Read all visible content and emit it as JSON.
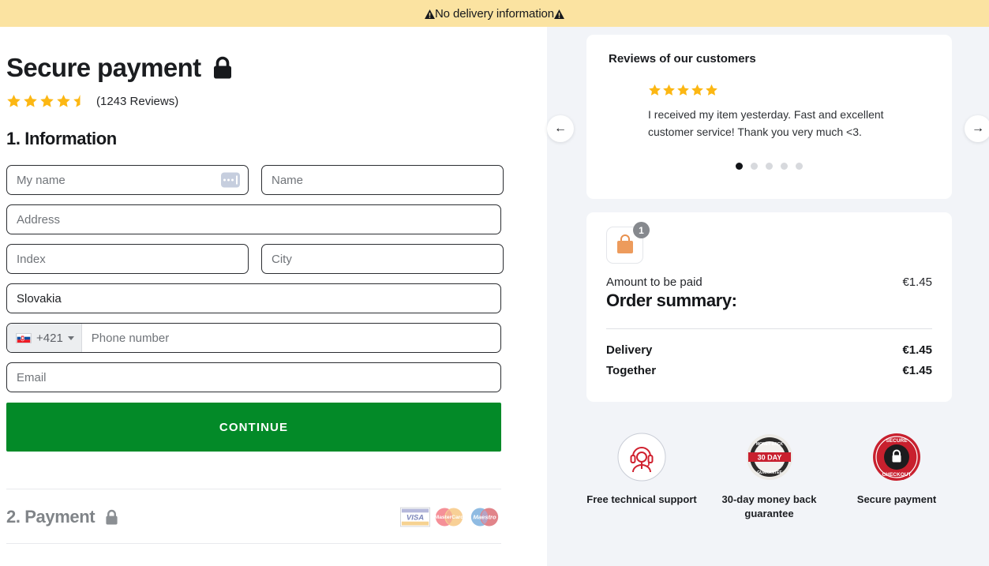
{
  "banner": {
    "text": "No delivery information",
    "icon_left": "warning-triangle-icon",
    "icon_right": "warning-triangle-icon",
    "bg_color": "#fbe3a1"
  },
  "header": {
    "title": "Secure payment",
    "lock_icon": "lock-icon",
    "rating_value": 4.5,
    "stars_total": 5,
    "reviews_text": "(1243 Reviews)"
  },
  "information": {
    "heading": "1. Information",
    "fields": {
      "my_name_placeholder": "My name",
      "name_placeholder": "Name",
      "address_placeholder": "Address",
      "index_placeholder": "Index",
      "city_placeholder": "City",
      "country_value": "Slovakia",
      "phone_dial_code": "+421",
      "phone_placeholder": "Phone number",
      "email_placeholder": "Email"
    },
    "continue_label": "CONTINUE"
  },
  "payment": {
    "heading": "2. Payment",
    "lock_icon": "lock-icon",
    "cards": [
      "VISA",
      "MasterCard",
      "Maestro"
    ]
  },
  "reviews": {
    "title": "Reviews of our customers",
    "stars": 5,
    "text": "I received my item yesterday. Fast and excellent customer service! Thank you very much <3.",
    "dots_total": 5,
    "active_dot": 1,
    "prev_icon": "arrow-left-icon",
    "next_icon": "arrow-right-icon"
  },
  "order_summary": {
    "bag_icon": "shopping-bag-icon",
    "item_count": "1",
    "amount_label": "Amount to be paid",
    "amount_value": "€1.45",
    "title": "Order summary:",
    "lines": [
      {
        "label": "Delivery",
        "value": "€1.45"
      },
      {
        "label": "Together",
        "value": "€1.45"
      }
    ]
  },
  "trust_badges": [
    {
      "label": "Free technical support",
      "icon": "headset-support-icon"
    },
    {
      "label": "30-day money back guarantee",
      "icon": "money-back-seal-icon",
      "seal_text": "30 DAY",
      "seal_top": "MONEY BACK",
      "seal_bottom": "GUARANTEE"
    },
    {
      "label": "Secure payment",
      "icon": "secure-checkout-badge-icon",
      "seal_top": "SECURE",
      "seal_bottom": "CHECKOUT"
    }
  ],
  "colors": {
    "accent_green": "#038a28",
    "star_yellow": "#fcb713",
    "panel_bg": "#f2f4f8",
    "badge_red": "#c8202e"
  }
}
